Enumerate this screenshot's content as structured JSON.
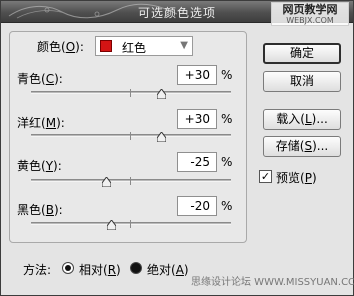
{
  "window": {
    "title": "可选颜色选项"
  },
  "watermark_top": {
    "line1": "网页教学网",
    "line2": "WEBJX.COM"
  },
  "colors": {
    "label": "颜色",
    "hotkey": "O",
    "value": "红色",
    "swatch": "#d41414"
  },
  "adjustments": [
    {
      "label": "青色",
      "hotkey": "C",
      "value": "+30",
      "unit": "%",
      "level": 0.65
    },
    {
      "label": "洋红",
      "hotkey": "M",
      "value": "+30",
      "unit": "%",
      "level": 0.65
    },
    {
      "label": "黄色",
      "hotkey": "Y",
      "value": "-25",
      "unit": "%",
      "level": 0.375
    },
    {
      "label": "黑色",
      "hotkey": "B",
      "value": "-20",
      "unit": "%",
      "level": 0.4
    }
  ],
  "buttons": {
    "ok": "确定",
    "cancel": "取消",
    "load": {
      "label": "载入",
      "hotkey": "L",
      "suffix": "..."
    },
    "save": {
      "label": "存储",
      "hotkey": "S",
      "suffix": "..."
    }
  },
  "preview": {
    "label": "预览",
    "hotkey": "P",
    "checked": true
  },
  "method": {
    "label": "方法:",
    "relative": {
      "label": "相对",
      "hotkey": "R",
      "selected": true
    },
    "absolute": {
      "label": "绝对",
      "hotkey": "A",
      "selected": false
    }
  },
  "watermark_bottom": "思缘设计论坛 WWW.MISSYUAN.COM"
}
